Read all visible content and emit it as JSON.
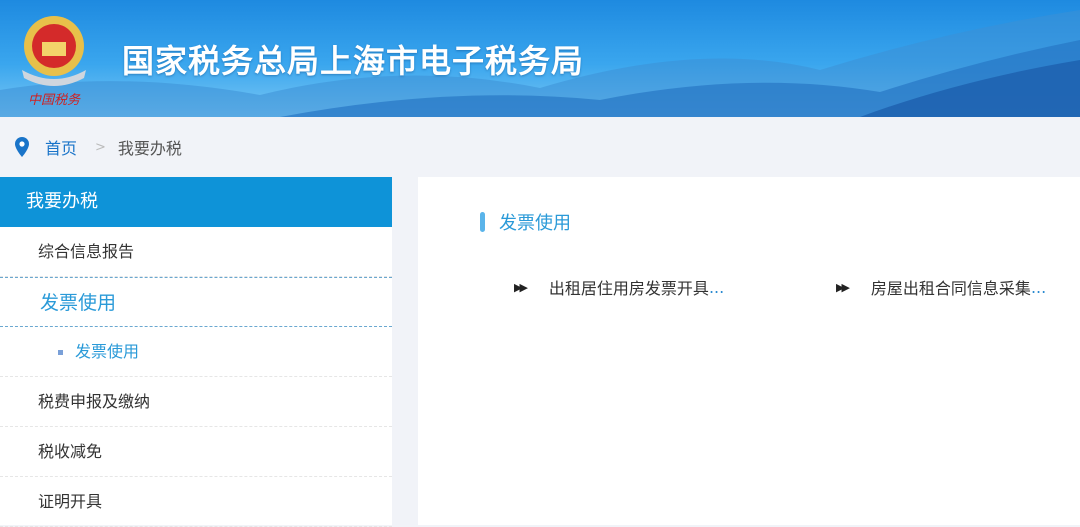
{
  "header": {
    "title": "国家税务总局上海市电子税务局",
    "emblem_text": "中国税务"
  },
  "breadcrumb": {
    "home": "首页",
    "separator": ">",
    "current": "我要办税"
  },
  "sidebar": {
    "title": "我要办税",
    "items": [
      {
        "label": "综合信息报告"
      },
      {
        "label": "发票使用"
      },
      {
        "label": "发票使用"
      },
      {
        "label": "税费申报及缴纳"
      },
      {
        "label": "税收减免"
      },
      {
        "label": "证明开具"
      }
    ]
  },
  "main": {
    "section_title": "发票使用",
    "links": [
      {
        "label": "出租居住用房发票开具",
        "ellipsis": "..."
      },
      {
        "label": "房屋出租合同信息采集",
        "ellipsis": "..."
      }
    ]
  },
  "colors": {
    "accent": "#0e93d8",
    "link": "#2a9ad8"
  }
}
